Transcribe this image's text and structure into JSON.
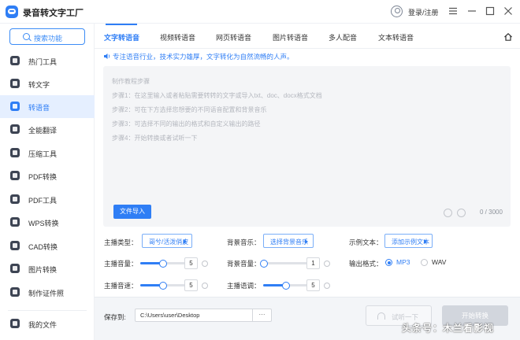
{
  "app": {
    "title": "录音转文字工厂",
    "login_label": "登录/注册"
  },
  "sidebar": {
    "search_label": "搜索功能",
    "items": [
      {
        "label": "热门工具",
        "icon": "fire-icon"
      },
      {
        "label": "转文字",
        "icon": "text-convert-icon"
      },
      {
        "label": "转语音",
        "icon": "voice-icon"
      },
      {
        "label": "全能翻译",
        "icon": "translate-icon"
      },
      {
        "label": "压缩工具",
        "icon": "compress-icon"
      },
      {
        "label": "PDF转换",
        "icon": "pdf-convert-icon"
      },
      {
        "label": "PDF工具",
        "icon": "pdf-tools-icon"
      },
      {
        "label": "WPS转换",
        "icon": "wps-icon"
      },
      {
        "label": "CAD转换",
        "icon": "cad-icon"
      },
      {
        "label": "图片转换",
        "icon": "image-convert-icon"
      },
      {
        "label": "制作证件照",
        "icon": "id-photo-icon"
      }
    ],
    "my_files_label": "我的文件",
    "active_index": 2
  },
  "tabs": [
    {
      "label": "文字转语音",
      "active": true
    },
    {
      "label": "视频转语音",
      "active": false
    },
    {
      "label": "网页转语音",
      "active": false
    },
    {
      "label": "图片转语音",
      "active": false
    },
    {
      "label": "多人配音",
      "active": false
    },
    {
      "label": "文本转语音",
      "active": false
    }
  ],
  "intro": "专注语音行业，技术实力雄厚，文字转化为自然流畅的人声。",
  "editor": {
    "tutorial": [
      "制作教程步骤",
      "步骤1：在这里输入或者粘贴需要转转的文字或导入txt、doc、docx格式文档",
      "步骤2：可在下方选择您想要的不同语音配置和背景音乐",
      "步骤3：可选择不同的输出的格式和自定义输出的路径",
      "步骤4：开始转换或者试听一下"
    ],
    "import_label": "文件导入",
    "char_count": "0 / 3000"
  },
  "settings": {
    "anchor_type": {
      "label": "主播类型：",
      "value": "哥兮/活泼俏皮"
    },
    "bg_music": {
      "label": "背景音乐：",
      "value": "选择背景音乐"
    },
    "sample_text": {
      "label": "示例文本：",
      "value": "添加示例文本"
    },
    "anchor_volume": {
      "label": "主播音量：",
      "value": "5",
      "level": 0.5
    },
    "bg_volume": {
      "label": "背景音量：",
      "value": "1",
      "level": 0.05
    },
    "output_format": {
      "label": "输出格式：",
      "options": [
        "MP3",
        "WAV"
      ],
      "selected": "MP3"
    },
    "anchor_speed": {
      "label": "主播音速：",
      "value": "5",
      "level": 0.5
    },
    "anchor_tone": {
      "label": "主播语调：",
      "value": "5",
      "level": 0.5
    }
  },
  "bottom": {
    "save_label": "保存到:",
    "save_path": "C:\\Users\\user\\Desktop",
    "browse_label": "···",
    "trial_label": "试听一下",
    "convert_label": "开始转换"
  },
  "watermark": "头条号：木兰看影视",
  "colors": {
    "accent": "#2f7ef5",
    "active_bg": "#e5efff",
    "disabled": "#d2d6dd"
  }
}
